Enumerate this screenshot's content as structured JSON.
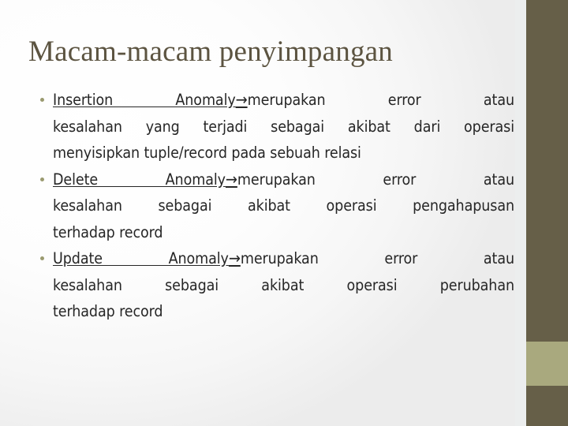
{
  "slide": {
    "title": "Macam-macam penyimpangan",
    "colors": {
      "title_text": "#5c5441",
      "body_text": "#262626",
      "sidebar_dark": "#665f48",
      "sidebar_accent": "#a9a97e",
      "bullet_marker": "#9a9a6f",
      "background": "#ffffff"
    },
    "bullets": [
      {
        "marker": "bullet-dot",
        "lead_underlined": "Insertion  Anomaly",
        "arrow": "→",
        "lines": [
          "merupakan    error    atau",
          "kesalahan yang terjadi sebagai akibat dari operasi",
          "menyisipkan tuple/record pada sebuah relasi"
        ],
        "full_text": "Insertion  Anomaly→ merupakan error atau kesalahan yang terjadi sebagai akibat dari operasi menyisipkan tuple/record pada sebuah relasi"
      },
      {
        "marker": "bullet-dot",
        "lead_underlined": "Delete  Anomaly",
        "arrow": "→",
        "lines": [
          "merupakan    error    atau",
          "kesalahan  sebagai  akibat  operasi  pengahapusan",
          "terhadap record"
        ],
        "full_text": "Delete  Anomaly→ merupakan error atau kesalahan sebagai akibat operasi pengahapusan terhadap record"
      },
      {
        "marker": "bullet-dot",
        "lead_underlined": "Update  Anomaly",
        "arrow": "→",
        "lines": [
          "merupakan    error    atau",
          "kesalahan  sebagai  akibat  operasi    perubahan",
          "terhadap record"
        ],
        "full_text": "Update  Anomaly→ merupakan error atau kesalahan sebagai akibat operasi perubahan terhadap record"
      }
    ]
  }
}
